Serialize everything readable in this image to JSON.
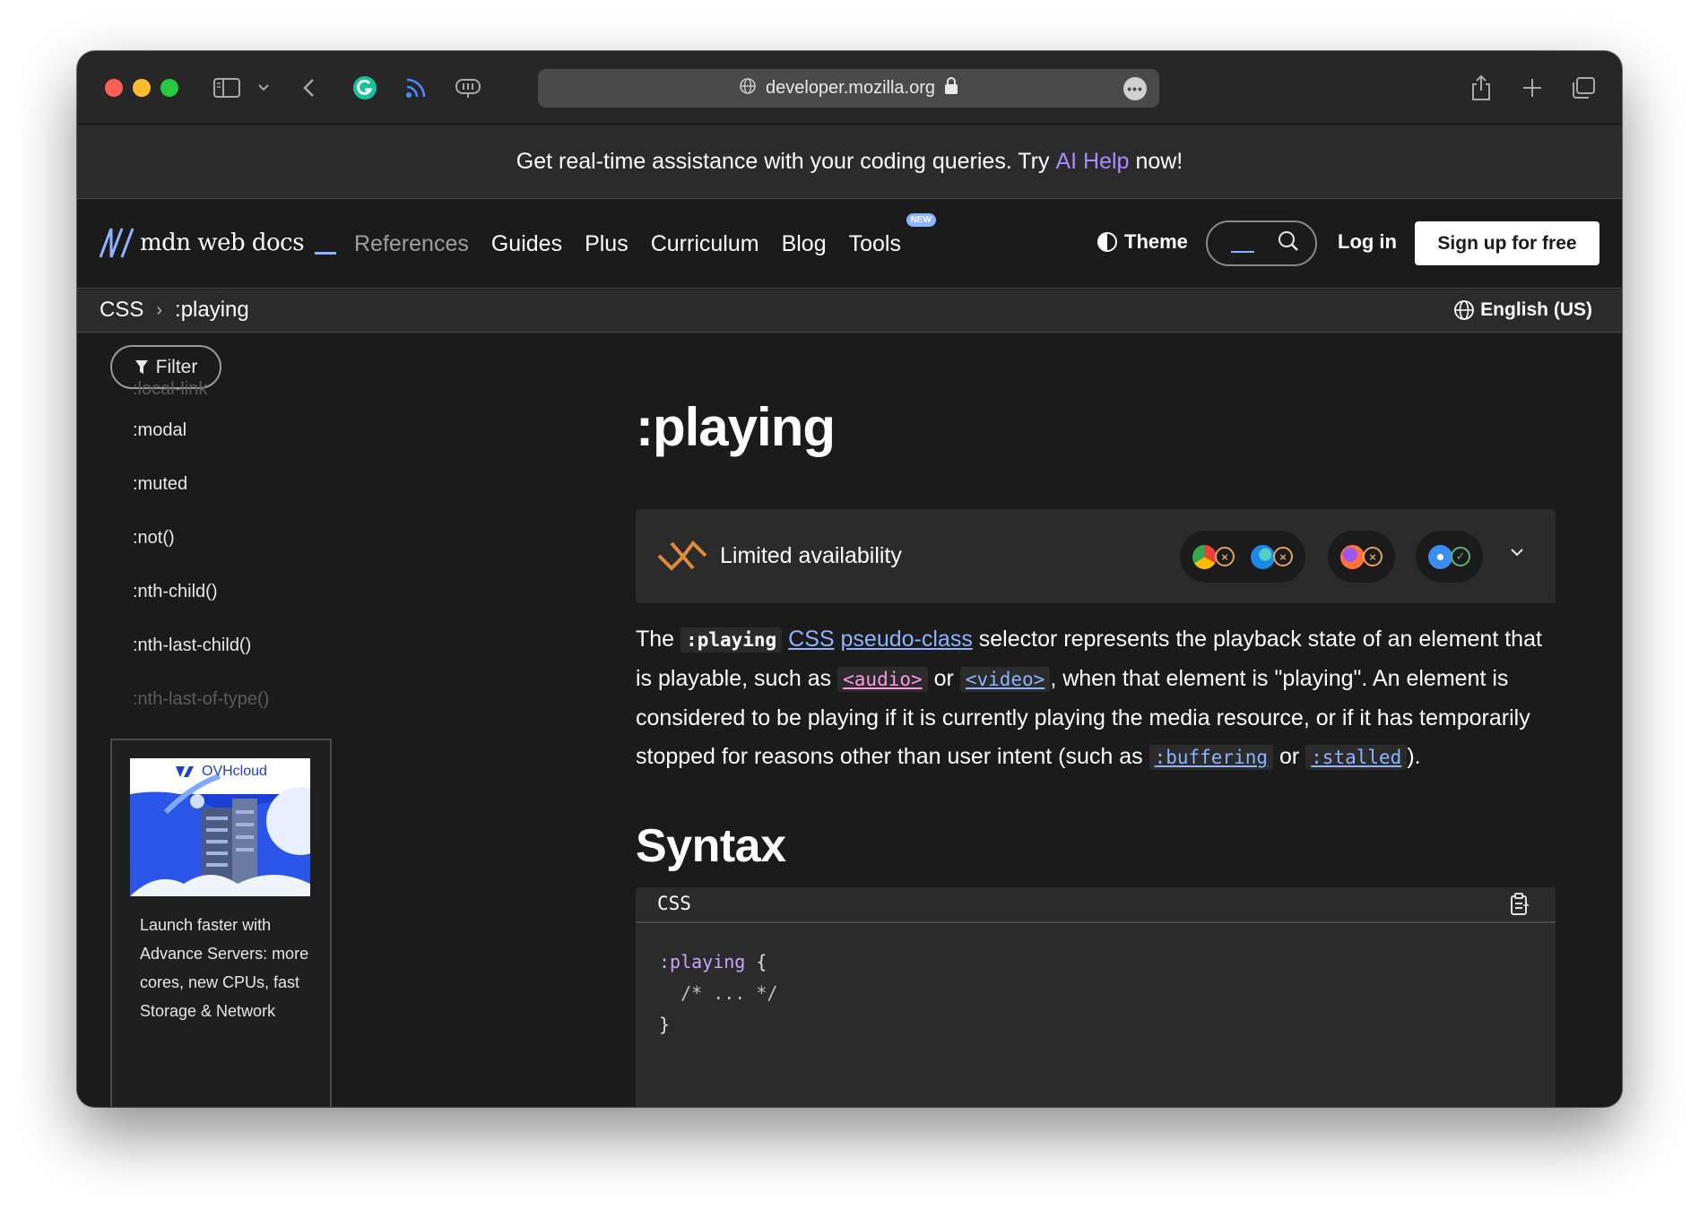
{
  "browser": {
    "url": "developer.mozilla.org"
  },
  "banner": {
    "text_before": "Get real-time assistance with your coding queries. Try",
    "link": "AI Help",
    "text_after": "now!"
  },
  "nav": {
    "logo": "mdn web docs",
    "links": [
      "References",
      "Guides",
      "Plus",
      "Curriculum",
      "Blog",
      "Tools"
    ],
    "new_badge": "NEW",
    "theme": "Theme",
    "login": "Log in",
    "signup": "Sign up for free"
  },
  "breadcrumb": {
    "items": [
      "CSS",
      ":playing"
    ],
    "language": "English (US)"
  },
  "sidebar": {
    "filter": "Filter",
    "items": [
      ":local-link",
      ":modal",
      ":muted",
      ":not()",
      ":nth-child()",
      ":nth-last-child()",
      ":nth-last-of-type()"
    ],
    "ad": {
      "brand": "OVHcloud",
      "text": "Launch faster with Advance Servers: more cores, new CPUs, fast Storage & Network"
    }
  },
  "article": {
    "title": ":playing",
    "availability": "Limited availability",
    "desc": {
      "t1": "The",
      "code1": ":playing",
      "link1": "CSS",
      "link2": "pseudo-class",
      "t2": "selector represents the playback state of an element that is playable, such as",
      "code2": "<audio>",
      "t3": "or",
      "code3": "<video>",
      "t4": ", when that element is \"playing\". An element is considered to be playing if it is currently playing the media resource, or if it has temporarily stopped for reasons other than user intent (such as",
      "code4": ":buffering",
      "t5": "or",
      "code5": ":stalled",
      "t6": ")."
    },
    "syntax_heading": "Syntax",
    "code": {
      "lang": "CSS",
      "line1_sel": ":playing",
      "line1_brace": " {",
      "line2": "  /* ... */",
      "line3": "}"
    }
  },
  "colors": {
    "accent_blue": "#8cb4ff",
    "ai_purple": "#a98bff",
    "code_pink": "#ff97e4",
    "bg_dark": "#1b1b1b",
    "panel": "#2b2b2b"
  }
}
